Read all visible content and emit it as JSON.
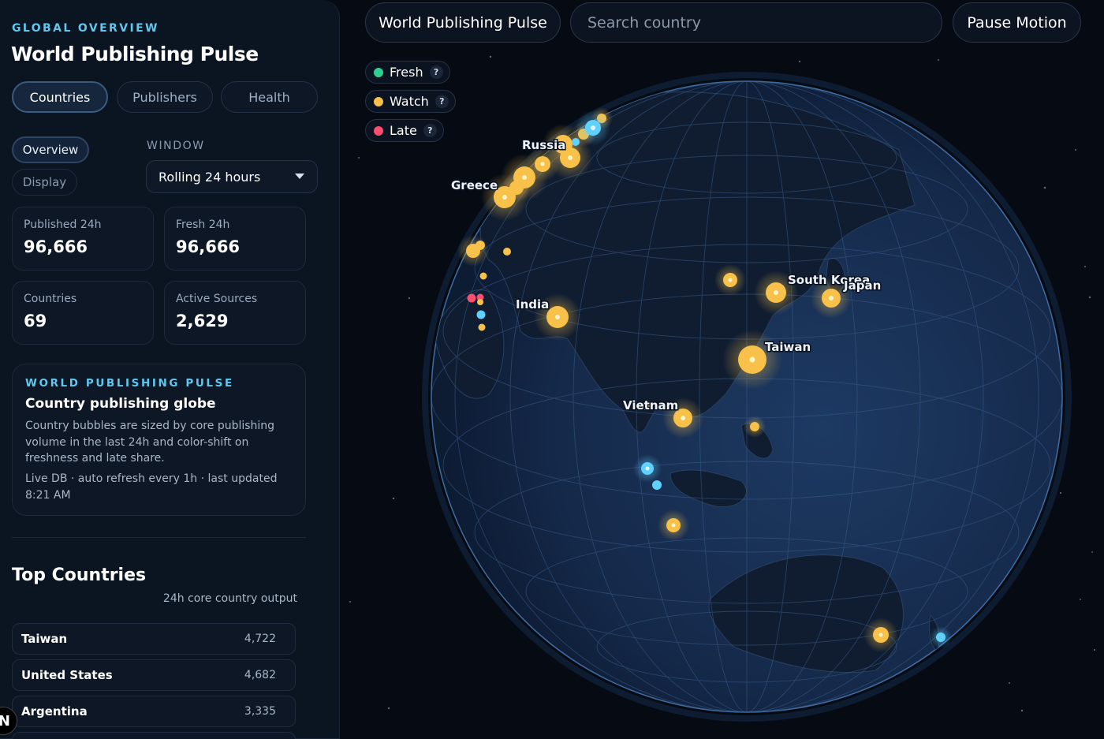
{
  "sidebar": {
    "eyebrow": "GLOBAL OVERVIEW",
    "title": "World Publishing Pulse",
    "tabs": [
      "Countries",
      "Publishers",
      "Health"
    ],
    "active_tab": "Countries",
    "views": [
      "Overview",
      "Display"
    ],
    "active_view": "Overview",
    "window_label": "WINDOW",
    "window_value": "Rolling 24 hours",
    "stats": [
      {
        "label": "Published 24h",
        "value": "96,666"
      },
      {
        "label": "Fresh 24h",
        "value": "96,666"
      },
      {
        "label": "Countries",
        "value": "69"
      },
      {
        "label": "Active Sources",
        "value": "2,629"
      }
    ],
    "info": {
      "eyebrow": "WORLD PUBLISHING PULSE",
      "title": "Country publishing globe",
      "description": "Country bubbles are sized by core publishing volume in the last 24h and color-shift on freshness and late share.",
      "meta": "Live DB · auto refresh every 1h · last updated 8:21 AM"
    },
    "top_countries": {
      "title": "Top Countries",
      "subtitle": "24h core country output",
      "rows": [
        {
          "name": "Taiwan",
          "value": "4,722"
        },
        {
          "name": "United States",
          "value": "4,682"
        },
        {
          "name": "Argentina",
          "value": "3,335"
        }
      ]
    },
    "corner_badge": "N"
  },
  "toolbar": {
    "title_button": "World Publishing Pulse",
    "search_placeholder": "Search country",
    "pause_button": "Pause Motion"
  },
  "legend": [
    {
      "label": "Fresh",
      "color": "#2fcf8f",
      "help": "?"
    },
    {
      "label": "Watch",
      "color": "#f7c14a",
      "help": "?"
    },
    {
      "label": "Late",
      "color": "#ff4d6d",
      "help": "?"
    }
  ],
  "globe": {
    "labels": {
      "russia": "Russia",
      "greece": "Greece",
      "india": "India",
      "south_korea": "South Korea",
      "japan": "Japan",
      "taiwan": "Taiwan",
      "vietnam": "Vietnam"
    },
    "colors": {
      "watch": "#f7c14a",
      "fresh_blue": "#5fd1ff",
      "late": "#ff4d6d"
    }
  }
}
